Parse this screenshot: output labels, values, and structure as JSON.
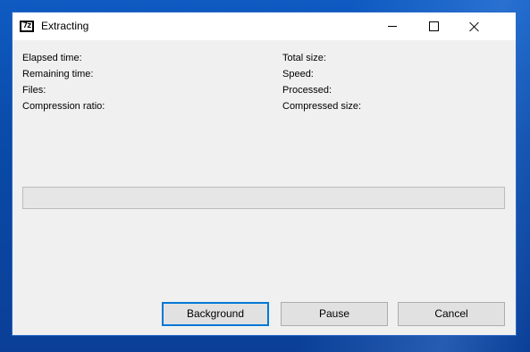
{
  "window": {
    "title": "Extracting",
    "app_icon": "7z-icon"
  },
  "title_controls": {
    "minimize": "minimize-icon",
    "maximize": "maximize-icon",
    "close": "close-icon"
  },
  "stats": {
    "left": {
      "elapsed_time": "Elapsed time:",
      "remaining_time": "Remaining time:",
      "files": "Files:",
      "compression_ratio": "Compression ratio:"
    },
    "right": {
      "total_size": "Total size:",
      "speed": "Speed:",
      "processed": "Processed:",
      "compressed_size": "Compressed size:"
    }
  },
  "progress": {
    "percent": 0,
    "fill_color": "#06b025"
  },
  "buttons": {
    "background": "Background",
    "pause": "Pause",
    "cancel": "Cancel"
  },
  "colors": {
    "desktop": "#0f5bc2",
    "window_bg": "#f0f0f0",
    "titlebar_bg": "#ffffff",
    "default_button_border": "#0078d7"
  }
}
